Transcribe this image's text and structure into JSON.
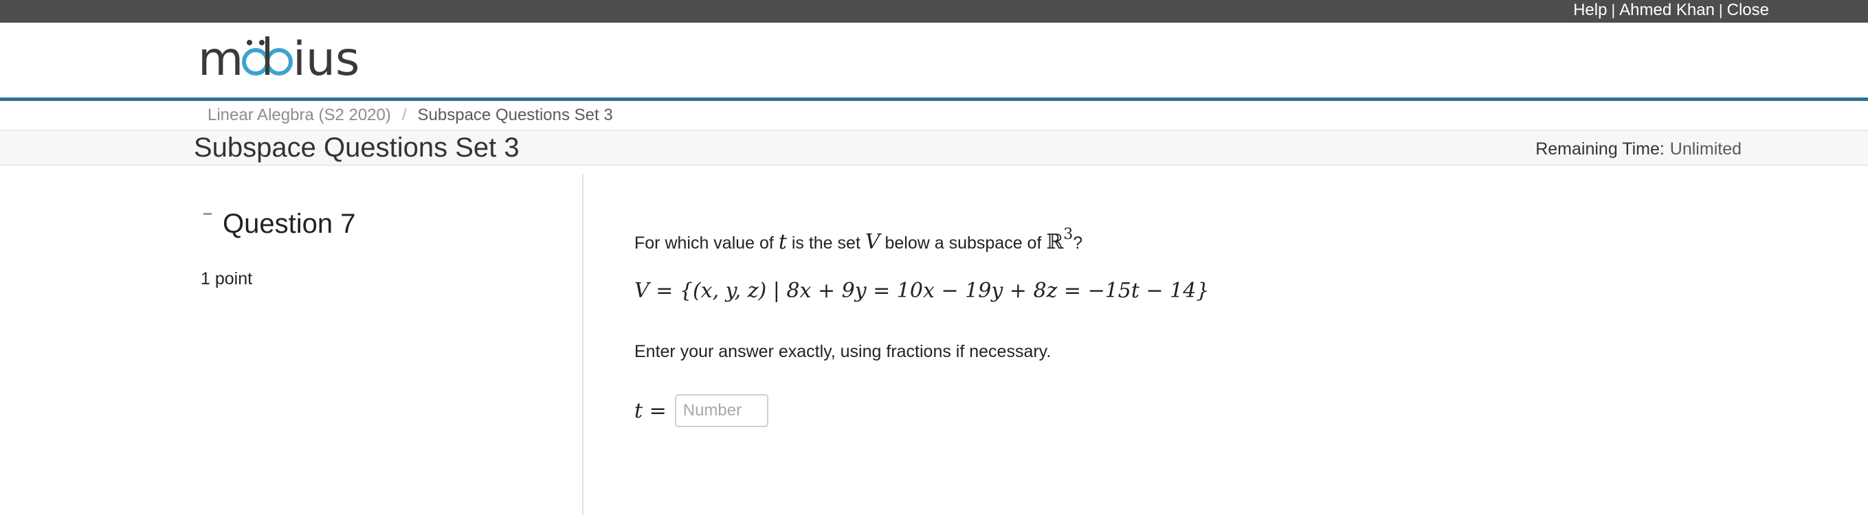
{
  "topbar": {
    "help_label": "Help",
    "user_label": "Ahmed Khan",
    "close_label": "Close",
    "separator": "|"
  },
  "logo": {
    "text": "möbius",
    "accent_color": "#3ba3d0"
  },
  "breadcrumb": {
    "course_label": "Linear Alegbra (S2 2020)",
    "separator": "/",
    "current_label": "Subspace Questions Set 3"
  },
  "page": {
    "title": "Subspace Questions Set 3",
    "remaining_label": "Remaining Time:",
    "remaining_value": "Unlimited"
  },
  "question": {
    "title": "Question 7",
    "points": "1 point",
    "prompt_part1": "For which value of ",
    "prompt_var_t": "t",
    "prompt_part2": " is the set ",
    "prompt_var_V": "V",
    "prompt_part3": " below a subspace of ",
    "prompt_field": "ℝ",
    "prompt_exponent": "3",
    "prompt_end": "?",
    "equation": {
      "lhs": "V",
      "rest": " = {(x, y, z) | 8x + 9y = 10x − 19y + 8z = −15t − 14}"
    },
    "instruction": "Enter your answer exactly, using fractions if necessary.",
    "answer_var": "t",
    "answer_equals": " =",
    "answer_placeholder": "Number",
    "answer_value": ""
  },
  "colors": {
    "topbar_bg": "#4d4d4d",
    "header_rule": "#2f6f99",
    "titlebar_bg": "#f7f7f7"
  }
}
